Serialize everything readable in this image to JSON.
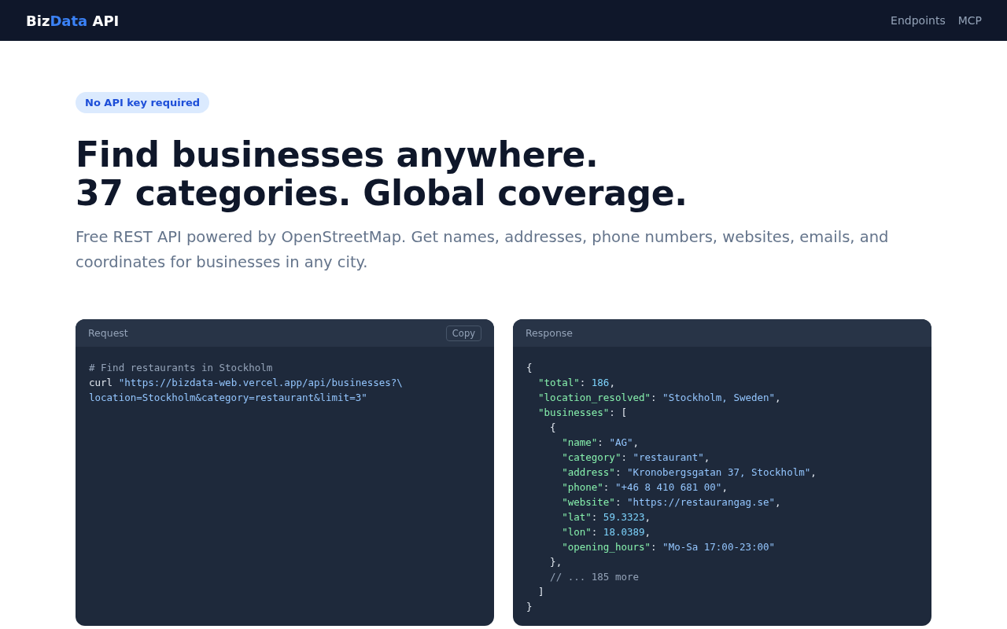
{
  "nav": {
    "logo": [
      {
        "kind": "plain",
        "text": "Biz"
      },
      {
        "kind": "accent",
        "text": "Data"
      },
      {
        "kind": "plain",
        "text": " API"
      }
    ],
    "links": [
      {
        "label": "Endpoints"
      },
      {
        "label": "MCP"
      }
    ]
  },
  "hero": {
    "badge": "No API key required",
    "title_lines": [
      "Find businesses anywhere.",
      "37 categories. Global coverage."
    ],
    "subtitle": "Free REST API powered by OpenStreetMap. Get names, addresses, phone numbers, websites, emails, and coordinates for businesses in any city."
  },
  "panels": [
    {
      "title": "Request",
      "copy_button": "Copy",
      "lines": [
        [
          {
            "kind": "comment",
            "text": "# Find restaurants in Stockholm"
          }
        ],
        [
          {
            "kind": "plain",
            "text": "curl "
          },
          {
            "kind": "string",
            "text": "\"https://bizdata-web.vercel.app/api/businesses?\\"
          }
        ],
        [
          {
            "kind": "string",
            "text": "location=Stockholm&category=restaurant&limit=3\""
          }
        ]
      ]
    },
    {
      "title": "Response",
      "lines": [
        [
          {
            "kind": "plain",
            "text": "{"
          }
        ],
        [
          {
            "kind": "key",
            "text": "  \"total\""
          },
          {
            "kind": "plain",
            "text": ": "
          },
          {
            "kind": "number",
            "text": "186"
          },
          {
            "kind": "plain",
            "text": ","
          }
        ],
        [
          {
            "kind": "key",
            "text": "  \"location_resolved\""
          },
          {
            "kind": "plain",
            "text": ": "
          },
          {
            "kind": "string",
            "text": "\"Stockholm, Sweden\""
          },
          {
            "kind": "plain",
            "text": ","
          }
        ],
        [
          {
            "kind": "key",
            "text": "  \"businesses\""
          },
          {
            "kind": "plain",
            "text": ": ["
          }
        ],
        [
          {
            "kind": "plain",
            "text": "    {"
          }
        ],
        [
          {
            "kind": "key",
            "text": "      \"name\""
          },
          {
            "kind": "plain",
            "text": ": "
          },
          {
            "kind": "string",
            "text": "\"AG\""
          },
          {
            "kind": "plain",
            "text": ","
          }
        ],
        [
          {
            "kind": "key",
            "text": "      \"category\""
          },
          {
            "kind": "plain",
            "text": ": "
          },
          {
            "kind": "string",
            "text": "\"restaurant\""
          },
          {
            "kind": "plain",
            "text": ","
          }
        ],
        [
          {
            "kind": "key",
            "text": "      \"address\""
          },
          {
            "kind": "plain",
            "text": ": "
          },
          {
            "kind": "string",
            "text": "\"Kronobergsgatan 37, Stockholm\""
          },
          {
            "kind": "plain",
            "text": ","
          }
        ],
        [
          {
            "kind": "key",
            "text": "      \"phone\""
          },
          {
            "kind": "plain",
            "text": ": "
          },
          {
            "kind": "string",
            "text": "\"+46 8 410 681 00\""
          },
          {
            "kind": "plain",
            "text": ","
          }
        ],
        [
          {
            "kind": "key",
            "text": "      \"website\""
          },
          {
            "kind": "plain",
            "text": ": "
          },
          {
            "kind": "string",
            "text": "\"https://restaurangag.se\""
          },
          {
            "kind": "plain",
            "text": ","
          }
        ],
        [
          {
            "kind": "key",
            "text": "      \"lat\""
          },
          {
            "kind": "plain",
            "text": ": "
          },
          {
            "kind": "number",
            "text": "59.3323"
          },
          {
            "kind": "plain",
            "text": ","
          }
        ],
        [
          {
            "kind": "key",
            "text": "      \"lon\""
          },
          {
            "kind": "plain",
            "text": ": "
          },
          {
            "kind": "number",
            "text": "18.0389"
          },
          {
            "kind": "plain",
            "text": ","
          }
        ],
        [
          {
            "kind": "key",
            "text": "      \"opening_hours\""
          },
          {
            "kind": "plain",
            "text": ": "
          },
          {
            "kind": "string",
            "text": "\"Mo-Sa 17:00-23:00\""
          }
        ],
        [
          {
            "kind": "plain",
            "text": "    },"
          }
        ],
        [
          {
            "kind": "comment",
            "text": "    // ... 185 more"
          }
        ],
        [
          {
            "kind": "plain",
            "text": "  ]"
          }
        ],
        [
          {
            "kind": "plain",
            "text": "}"
          }
        ]
      ]
    }
  ]
}
